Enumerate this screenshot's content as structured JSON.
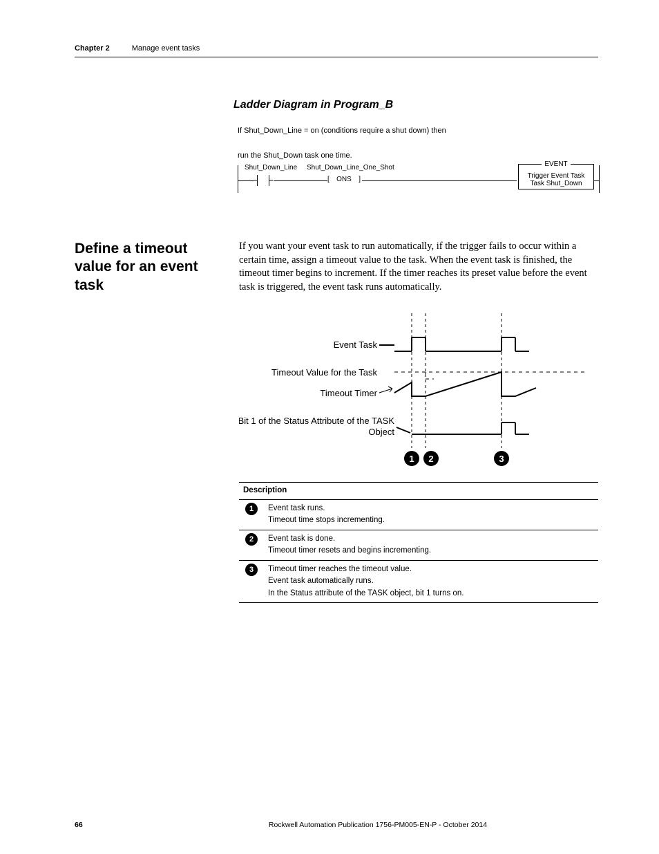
{
  "header": {
    "chapter": "Chapter 2",
    "chapter_title": "Manage event tasks"
  },
  "ladder": {
    "subtitle": "Ladder Diagram in Program_B",
    "condition": "If Shut_Down_Line = on (conditions require a shut down) then",
    "step": "run the Shut_Down task one time.",
    "tag_contact": "Shut_Down_Line",
    "tag_ons": "Shut_Down_Line_One_Shot",
    "ons_label": "ONS",
    "event_box": {
      "title": "EVENT",
      "line1": "Trigger Event Task",
      "line2": "Task   Shut_Down"
    }
  },
  "section": {
    "heading": "Define a timeout value for an event task",
    "body": "If you want your event task to run automatically, if the trigger fails to occur within a certain time, assign a timeout value to the task. When the event task is finished, the timeout timer begins to increment. If the timer reaches its preset value before the event task is triggered, the event task runs automatically."
  },
  "timing_labels": {
    "l1": "Event Task",
    "l2": "Timeout Value for the Task",
    "l3": "Timeout Timer",
    "l4a": "Bit 1 of the Status Attribute of the TASK",
    "l4b": "Object"
  },
  "desc_table": {
    "header": "Description",
    "rows": [
      {
        "n": "1",
        "lines": [
          "Event task runs.",
          "Timeout time stops incrementing."
        ]
      },
      {
        "n": "2",
        "lines": [
          "Event task is done.",
          "Timeout timer resets and begins incrementing."
        ]
      },
      {
        "n": "3",
        "lines": [
          "Timeout timer reaches the timeout value.",
          "Event task automatically runs.",
          "In the Status attribute of the TASK object, bit 1 turns on."
        ]
      }
    ]
  },
  "footer": {
    "page": "66",
    "text": "Rockwell Automation Publication 1756-PM005-EN-P - October 2014"
  },
  "colors": {
    "accent": "#000000"
  }
}
